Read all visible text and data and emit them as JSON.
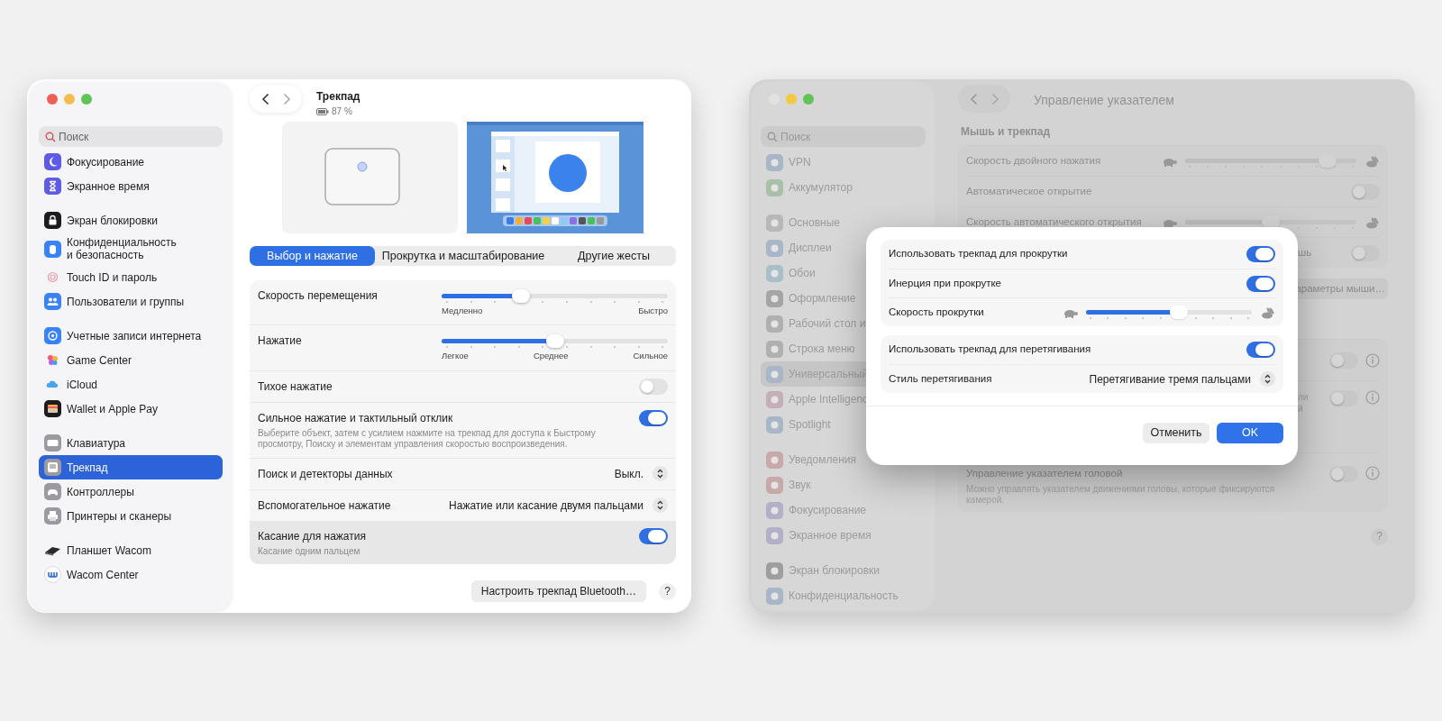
{
  "trackpad_window": {
    "sidebar": {
      "search": {
        "placeholder": "Поиск"
      },
      "sections": [
        {
          "items": [
            {
              "label": "Фокусирование",
              "selected": false
            },
            {
              "label": "Экранное время",
              "selected": false
            }
          ]
        },
        {
          "items": [
            {
              "label": "Экран блокировки",
              "selected": false
            },
            {
              "label": "Конфиденциальность\nи безопасность",
              "selected": false
            },
            {
              "label": "Touch ID и пароль",
              "selected": false
            },
            {
              "label": "Пользователи и группы",
              "selected": false
            }
          ]
        },
        {
          "items": [
            {
              "label": "Учетные записи интернета",
              "selected": false
            },
            {
              "label": "Game Center",
              "selected": false
            },
            {
              "label": "iCloud",
              "selected": false
            },
            {
              "label": "Wallet и Apple Pay",
              "selected": false
            }
          ]
        },
        {
          "items": [
            {
              "label": "Клавиатура",
              "selected": false
            },
            {
              "label": "Трекпад",
              "selected": true
            },
            {
              "label": "Контроллеры",
              "selected": false
            },
            {
              "label": "Принтеры и сканеры",
              "selected": false
            }
          ]
        },
        {
          "items": [
            {
              "label": "Планшет Wacom",
              "selected": false
            },
            {
              "label": "Wacom Center",
              "selected": false
            }
          ]
        }
      ]
    },
    "header": {
      "title": "Трекпад",
      "battery": "87 %"
    },
    "tabs": [
      {
        "label": "Выбор и нажатие",
        "selected": true
      },
      {
        "label": "Прокрутка и масштабирование",
        "selected": false
      },
      {
        "label": "Другие жесты",
        "selected": false
      }
    ],
    "settings": [
      {
        "kind": "slider",
        "label": "Скорость перемещения",
        "level": 0.35,
        "scale_labels": [
          "Медленно",
          "Быстро"
        ],
        "highlighted": false
      },
      {
        "kind": "slider",
        "label": "Нажатие",
        "level": 0.5,
        "scale_labels": [
          "Легкое",
          "Среднее",
          "Сильное"
        ],
        "highlighted": false
      },
      {
        "kind": "toggle",
        "label": "Тихое нажатие",
        "on": false,
        "highlighted": false
      },
      {
        "kind": "toggle",
        "label": "Сильное нажатие и тактильный отклик",
        "on": true,
        "description": [
          "Выберите объект, затем с усилием нажмите на трекпад для доступа к Быстрому",
          "просмотру, Поиску и элементам управления скоростью воспроизведения."
        ],
        "highlighted": false
      },
      {
        "kind": "popup",
        "label": "Поиск и детекторы данных",
        "value": "Выкл.",
        "highlighted": false
      },
      {
        "kind": "popup",
        "label": "Вспомогательное нажатие",
        "value": "Нажатие или касание двумя пальцами",
        "highlighted": false
      },
      {
        "kind": "toggle",
        "label": "Касание для нажатия",
        "on": true,
        "description": [
          "Касание одним пальцем"
        ],
        "highlighted": true
      }
    ],
    "footer": {
      "button": "Настроить трекпад Bluetooth…",
      "help": "?"
    }
  },
  "pointer_window": {
    "sidebar": {
      "search": {
        "placeholder": "Поиск"
      },
      "sections": [
        {
          "items": [
            {
              "label": "VPN",
              "selected": false
            },
            {
              "label": "Аккумулятор",
              "selected": false
            }
          ]
        },
        {
          "items": [
            {
              "label": "Основные",
              "selected": false
            },
            {
              "label": "Дисплеи",
              "selected": false
            },
            {
              "label": "Обои",
              "selected": false
            },
            {
              "label": "Оформление",
              "selected": false
            },
            {
              "label": "Рабочий стол и",
              "selected": false
            },
            {
              "label": "Строка меню",
              "selected": false
            },
            {
              "label": "Универсальный",
              "selected": true
            },
            {
              "label": "Apple Intelligenc",
              "selected": false
            },
            {
              "label": "Spotlight",
              "selected": false
            }
          ]
        },
        {
          "items": [
            {
              "label": "Уведомления",
              "selected": false
            },
            {
              "label": "Звук",
              "selected": false
            },
            {
              "label": "Фокусирование",
              "selected": false
            },
            {
              "label": "Экранное время",
              "selected": false
            }
          ]
        },
        {
          "items": [
            {
              "label": "Экран блокировки",
              "selected": false
            },
            {
              "label": "Конфиденциальность",
              "selected": false
            }
          ]
        }
      ]
    },
    "title": "Управление указателем",
    "section_title": "Мышь и трекпад",
    "group_1": [
      {
        "kind": "speed_slider",
        "label": "Скорость двойного нажатия",
        "level": 0.83
      },
      {
        "kind": "toggle",
        "label": "Автоматическое открытие",
        "on": false
      },
      {
        "kind": "speed_slider",
        "label": "Скорость автоматического открытия",
        "level": 0.5
      },
      {
        "kind": "toggle",
        "label": "шь",
        "on": false
      }
    ],
    "button": "араметры мыши…",
    "group_2": [
      {
        "kind": "toggle_info",
        "on": false
      },
      {
        "kind": "toggle_info",
        "on": false,
        "description": [
          "ли",
          "й"
        ]
      },
      {
        "kind": "toggle_info",
        "label": "Управление указателем головой",
        "on": false,
        "description": [
          "Можно управлять указателем движениями головы, которые фиксируются",
          "камерой."
        ]
      }
    ],
    "help": "?",
    "dialog": {
      "group_1": [
        {
          "kind": "toggle",
          "label": "Использовать трекпад для прокрутки",
          "on": true
        },
        {
          "kind": "toggle",
          "label": "Инерция при прокрутке",
          "on": true
        },
        {
          "kind": "speed_slider",
          "label": "Скорость прокрутки",
          "level": 0.56
        }
      ],
      "group_2": [
        {
          "kind": "toggle",
          "label": "Использовать трекпад для перетягивания",
          "on": true
        },
        {
          "kind": "popup",
          "label": "Стиль перетягивания",
          "value": "Перетягивание тремя пальцами"
        }
      ],
      "buttons": [
        {
          "label": "Отменить",
          "kind": "secondary"
        },
        {
          "label": "OK",
          "kind": "primary"
        }
      ]
    }
  }
}
